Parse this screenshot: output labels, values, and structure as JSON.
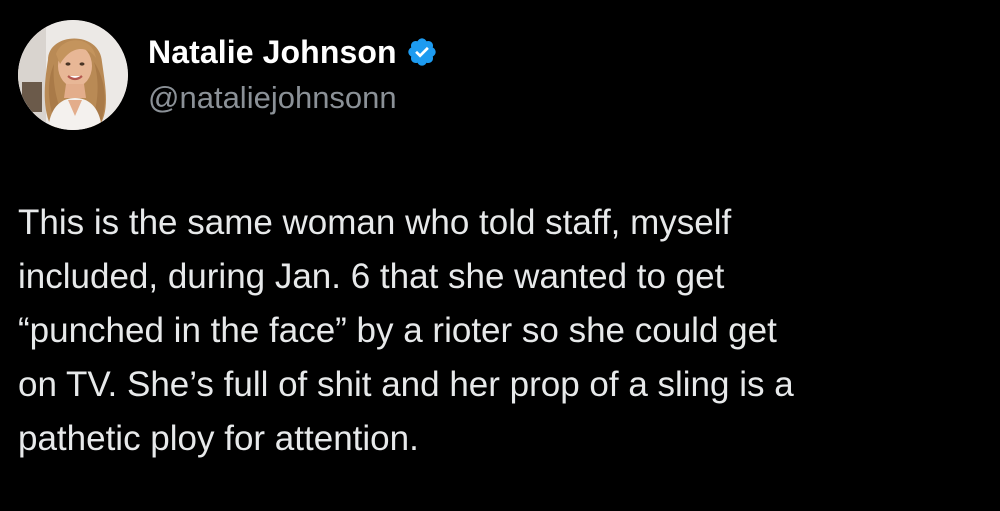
{
  "author": {
    "display_name": "Natalie Johnson",
    "handle": "@nataliejohnsonn",
    "verified": true,
    "verified_color": "#1d9bf0",
    "avatar_icon": "profile-photo"
  },
  "tweet": {
    "lines": [
      "This is the same woman who told staff, myself",
      "included, during Jan. 6 that she wanted to get",
      "“punched in the face” by a rioter so she could get",
      "on TV. She’s full of shit and her prop of a sling is a",
      "pathetic ploy for attention."
    ]
  },
  "colors": {
    "background": "#000000",
    "text": "#e7e9ea",
    "secondary_text": "#8b9197"
  }
}
